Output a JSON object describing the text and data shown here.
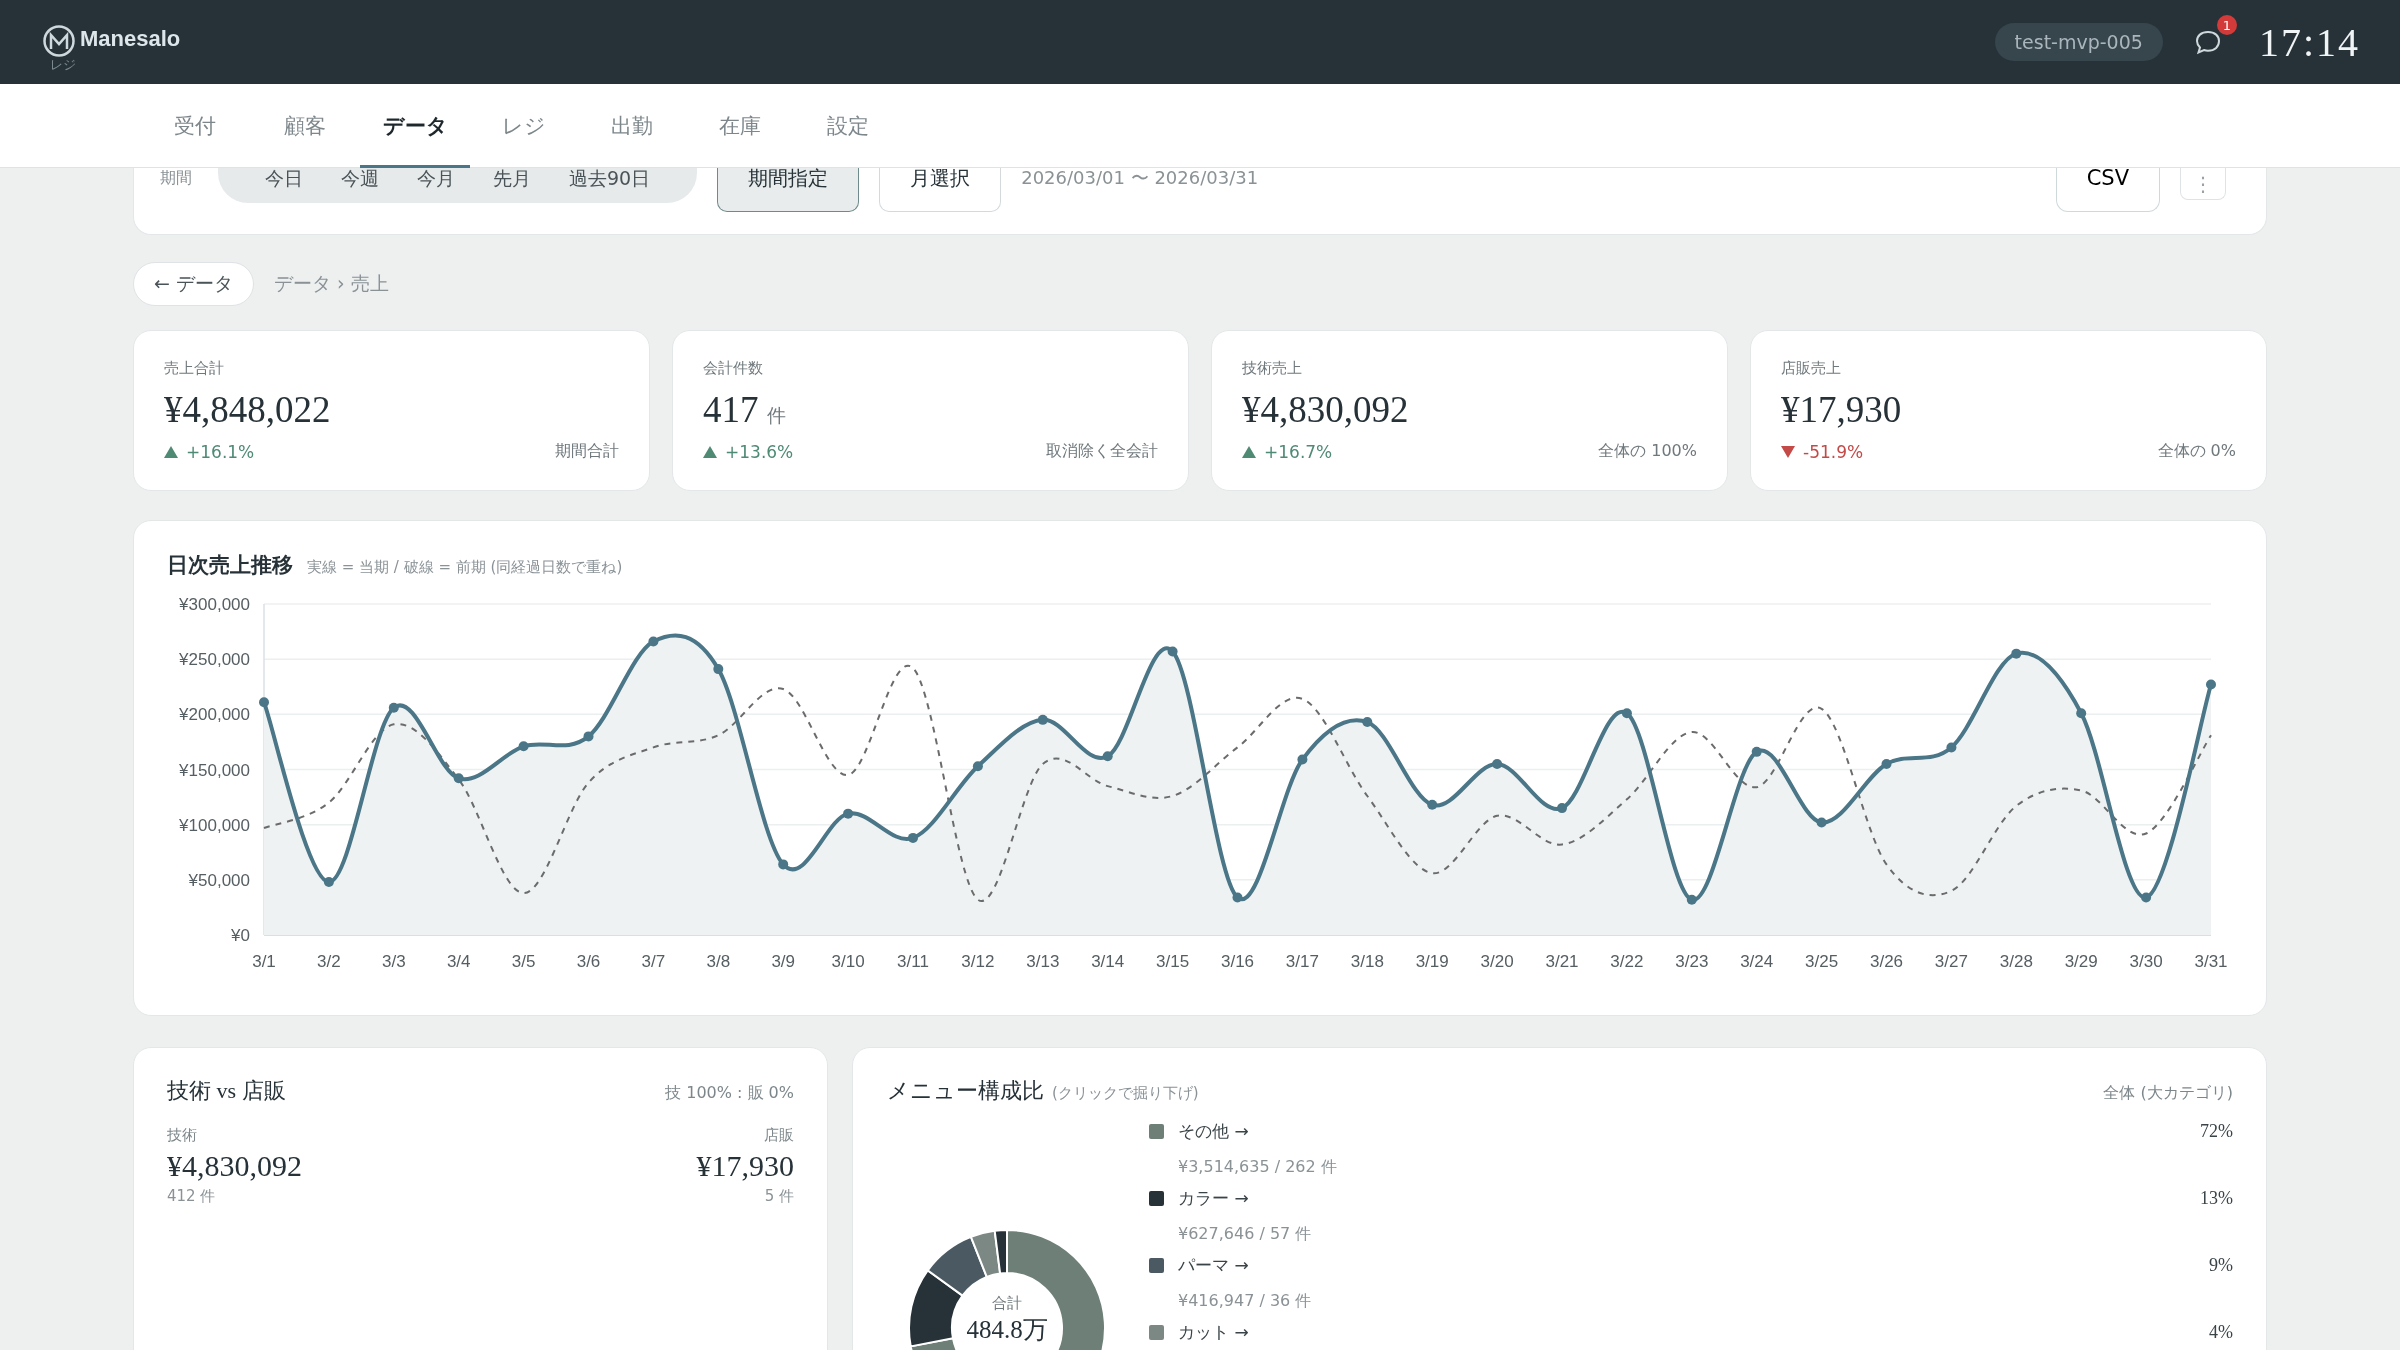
{
  "header": {
    "brand": "Manesalo",
    "subtitle": "レジ",
    "account": "test-mvp-005",
    "notifications": "1",
    "time": "17:14"
  },
  "nav": [
    {
      "label": "受付",
      "selected": false
    },
    {
      "label": "顧客",
      "selected": false
    },
    {
      "label": "データ",
      "selected": true
    },
    {
      "label": "レジ",
      "selected": false
    },
    {
      "label": "出勤",
      "selected": false
    },
    {
      "label": "在庫",
      "selected": false
    },
    {
      "label": "設定",
      "selected": false
    }
  ],
  "filter": {
    "label": "期間",
    "presets": [
      {
        "label": "今日",
        "selected": false
      },
      {
        "label": "今週",
        "selected": false
      },
      {
        "label": "今月",
        "selected": false
      },
      {
        "label": "先月",
        "selected": false
      },
      {
        "label": "過去90日",
        "selected": false
      }
    ],
    "modes": [
      {
        "label": "期間指定",
        "selected": true
      },
      {
        "label": "月選択",
        "selected": false
      }
    ],
    "range": "2026/03/01 〜 2026/03/31",
    "export": "CSV",
    "more": "⋮"
  },
  "breadcrumb": {
    "back": "← データ",
    "path": "データ › 売上"
  },
  "kpis": [
    {
      "label": "売上合計",
      "value": "¥4,848,022",
      "delta": "+16.1%",
      "falling": false,
      "note": "期間合計"
    },
    {
      "label": "会計件数",
      "value": "417",
      "unit": "件",
      "delta": "+13.6%",
      "falling": false,
      "note": "取消除く全会計"
    },
    {
      "label": "技術売上",
      "value": "¥4,830,092",
      "delta": "+16.7%",
      "falling": false,
      "note": "全体の 100%"
    },
    {
      "label": "店販売上",
      "value": "¥17,930",
      "delta": "-51.9%",
      "falling": true,
      "note": "全体の 0%"
    }
  ],
  "daily": {
    "title": "日次売上推移",
    "subtitle": "実線 = 当期 / 破線 = 前期 (同経過日数で重ね)",
    "chart_data": {
      "type": "line",
      "categories": [
        "3/1",
        "3/2",
        "3/3",
        "3/4",
        "3/5",
        "3/6",
        "3/7",
        "3/8",
        "3/9",
        "3/10",
        "3/11",
        "3/12",
        "3/13",
        "3/14",
        "3/15",
        "3/16",
        "3/17",
        "3/18",
        "3/19",
        "3/20",
        "3/21",
        "3/22",
        "3/23",
        "3/24",
        "3/25",
        "3/26",
        "3/27",
        "3/28",
        "3/29",
        "3/30",
        "3/31"
      ],
      "ylim": [
        0,
        300000
      ],
      "grid": true,
      "yticks": [
        {
          "value": 0,
          "label": "¥0"
        },
        {
          "value": 50000,
          "label": "¥50,000"
        },
        {
          "value": 100000,
          "label": "¥100,000"
        },
        {
          "value": 150000,
          "label": "¥150,000"
        },
        {
          "value": 200000,
          "label": "¥200,000"
        },
        {
          "value": 250000,
          "label": "¥250,000"
        },
        {
          "value": 300000,
          "label": "¥300,000"
        }
      ],
      "series": [
        {
          "type": "area",
          "color": "#4a7687",
          "marker": true,
          "line_style": "solid",
          "values": [
            211000,
            48000,
            206000,
            142000,
            171000,
            180000,
            266000,
            241000,
            64000,
            110000,
            88000,
            153000,
            195000,
            162000,
            257000,
            34000,
            159000,
            193000,
            118000,
            155000,
            115000,
            201000,
            32000,
            166000,
            102000,
            155000,
            170000,
            255000,
            201000,
            34000,
            227000
          ]
        },
        {
          "type": "line",
          "color": "#6b6b6b",
          "marker": false,
          "line_style": "dashed",
          "values": [
            97000,
            120000,
            191000,
            141000,
            38000,
            138000,
            170000,
            181000,
            223000,
            145000,
            242000,
            32000,
            155000,
            135000,
            126000,
            170000,
            214000,
            126000,
            56000,
            108000,
            82000,
            123000,
            184000,
            134000,
            205000,
            64000,
            40000,
            117000,
            131000,
            92000,
            181000
          ]
        }
      ]
    }
  },
  "split": {
    "title": "技術 vs 店販",
    "ratio": "技 100% : 販 0%",
    "left": {
      "label": "技術",
      "value": "¥4,830,092",
      "count": "412 件"
    },
    "right": {
      "label": "店販",
      "value": "¥17,930",
      "count": "5 件"
    }
  },
  "menu": {
    "title": "メニュー構成比",
    "hint": "(クリックで掘り下げ)",
    "scope": "全体 (大カテゴリ)",
    "total_label": "合計",
    "total": "484.8万",
    "chart_data": {
      "type": "donut",
      "values": [
        72,
        13,
        9,
        4,
        2
      ]
    },
    "items": [
      {
        "name": "その他 →",
        "detail": "¥3,514,635 / 262 件",
        "share": "72%",
        "color": "#6e7f78"
      },
      {
        "name": "カラー →",
        "detail": "¥627,646 / 57 件",
        "share": "13%",
        "color": "#263238"
      },
      {
        "name": "パーマ →",
        "detail": "¥416,947 / 36 件",
        "share": "9%",
        "color": "#4b5a62"
      },
      {
        "name": "カット →",
        "share": "4%",
        "color": "#7c8884"
      }
    ]
  }
}
